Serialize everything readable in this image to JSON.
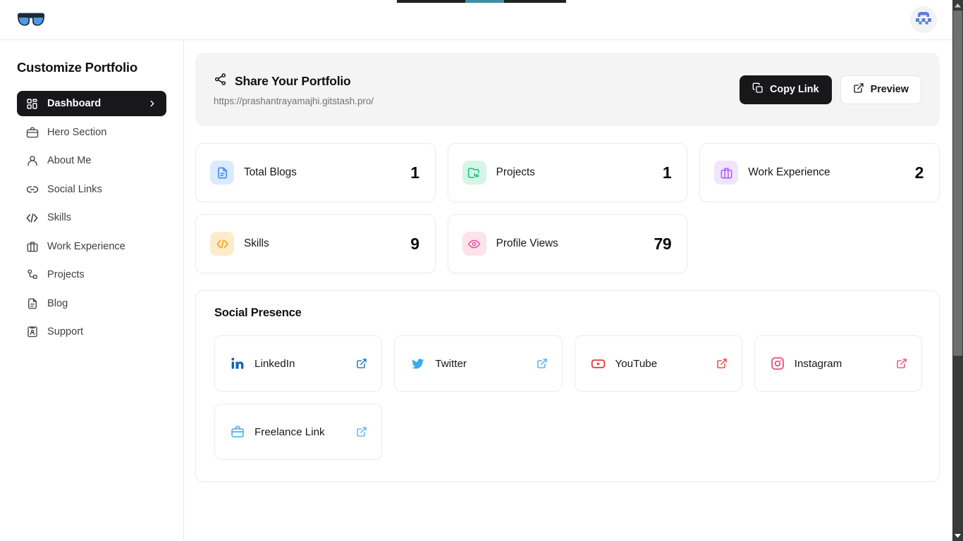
{
  "browser": {
    "tab_strip_visible": true,
    "tab_highlight_color": "#3f8da8"
  },
  "header": {
    "logo_icon": "sunglasses-icon",
    "logo_color": "#4a90e2",
    "avatar_icon": "user-avatar-identicon",
    "avatar_color": "#5b7fd4"
  },
  "sidebar": {
    "title": "Customize Portfolio",
    "items": [
      {
        "label": "Dashboard",
        "icon": "layout-grid-icon",
        "active": true,
        "chevron": "chevron-right-icon"
      },
      {
        "label": "Hero Section",
        "icon": "briefcase-icon",
        "active": false
      },
      {
        "label": "About Me",
        "icon": "user-icon",
        "active": false
      },
      {
        "label": "Social Links",
        "icon": "link-icon",
        "active": false
      },
      {
        "label": "Skills",
        "icon": "code-icon",
        "active": false
      },
      {
        "label": "Work Experience",
        "icon": "briefcase-alt-icon",
        "active": false
      },
      {
        "label": "Projects",
        "icon": "git-branch-icon",
        "active": false
      },
      {
        "label": "Blog",
        "icon": "file-text-icon",
        "active": false
      },
      {
        "label": "Support",
        "icon": "id-card-icon",
        "active": false
      }
    ]
  },
  "share": {
    "icon": "share-icon",
    "title": "Share Your Portfolio",
    "url": "https://prashantrayamajhi.gitstash.pro/",
    "copy_label": "Copy Link",
    "copy_icon": "copy-icon",
    "preview_label": "Preview",
    "preview_icon": "external-link-icon"
  },
  "stats": [
    {
      "label": "Total Blogs",
      "value": "1",
      "icon": "file-text-icon",
      "chip_bg": "#dbeafe",
      "icon_color": "#3b82f6"
    },
    {
      "label": "Projects",
      "value": "1",
      "icon": "folder-git-icon",
      "chip_bg": "#d7f5e6",
      "icon_color": "#10b981"
    },
    {
      "label": "Work Experience",
      "value": "2",
      "icon": "briefcase-icon",
      "chip_bg": "#f1e4fd",
      "icon_color": "#a855f7"
    },
    {
      "label": "Skills",
      "value": "9",
      "icon": "code-icon",
      "chip_bg": "#fdeccb",
      "icon_color": "#f59e0b"
    },
    {
      "label": "Profile Views",
      "value": "79",
      "icon": "eye-icon",
      "chip_bg": "#fde2ea",
      "icon_color": "#ec4899"
    }
  ],
  "social": {
    "heading": "Social Presence",
    "links": [
      {
        "label": "LinkedIn",
        "icon": "linkedin-icon",
        "color": "#0a66c2"
      },
      {
        "label": "Twitter",
        "icon": "twitter-icon",
        "color": "#3aa9f0"
      },
      {
        "label": "YouTube",
        "icon": "youtube-icon",
        "color": "#ef2e2e"
      },
      {
        "label": "Instagram",
        "icon": "instagram-icon",
        "color": "#e8446e"
      },
      {
        "label": "Freelance Link",
        "icon": "briefcase-icon",
        "color": "#4ab3e8"
      }
    ],
    "external_icon": "external-link-icon"
  },
  "scrollbar": {
    "icon_top": "caret-up-icon",
    "icon_bottom": "caret-down-icon"
  }
}
